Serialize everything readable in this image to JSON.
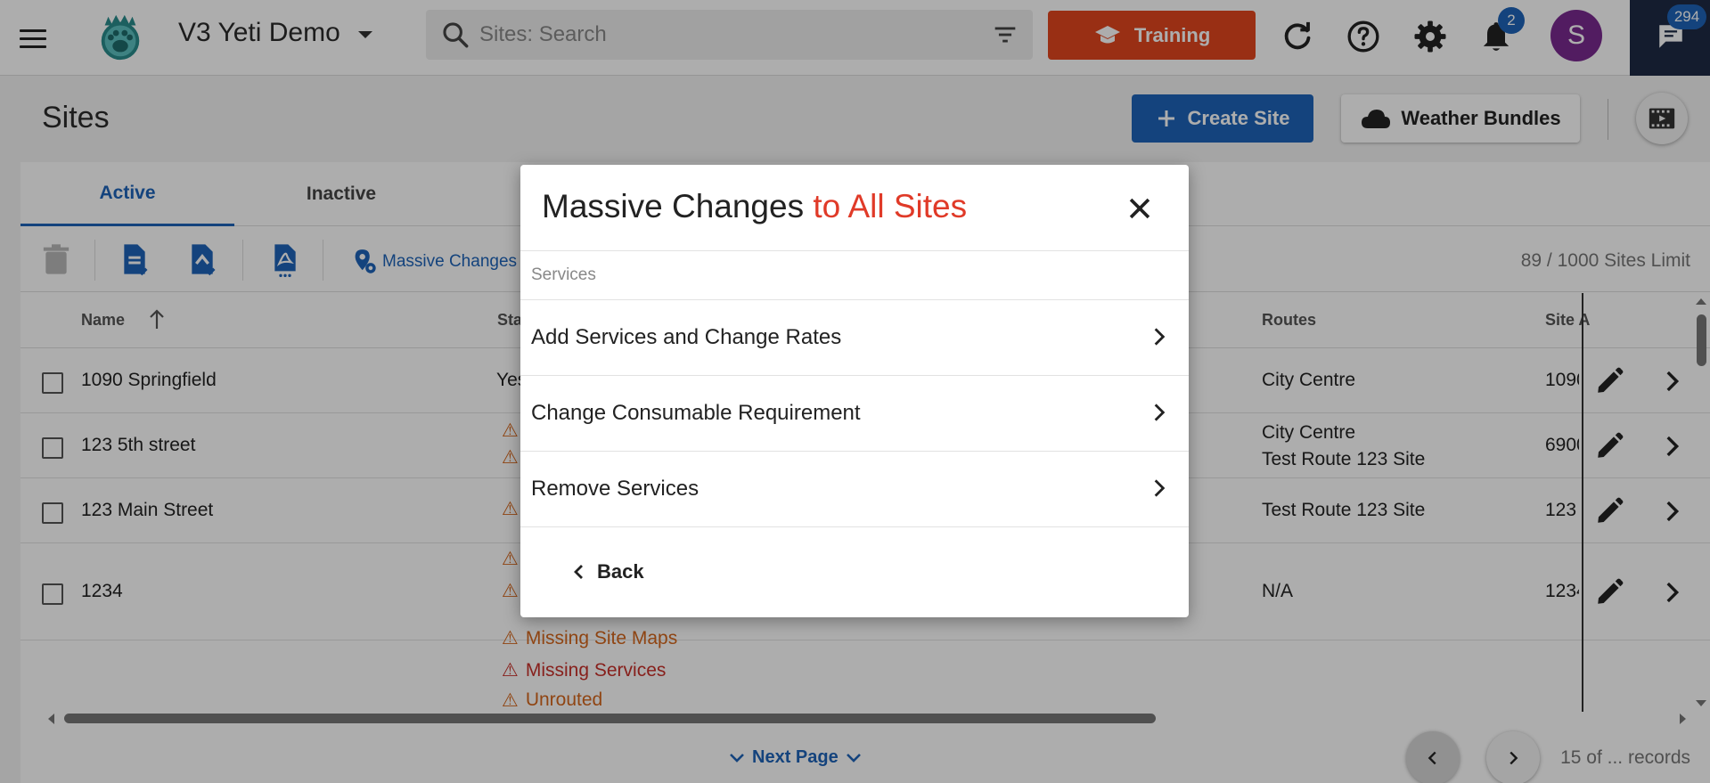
{
  "topbar": {
    "company_name": "V3 Yeti Demo",
    "search_placeholder": "Sites: Search",
    "training_label": "Training",
    "notifications_count": "2",
    "avatar_initial": "S",
    "chat_count": "294"
  },
  "page": {
    "title": "Sites",
    "create_site_label": "Create Site",
    "weather_bundles_label": "Weather Bundles"
  },
  "tabs": [
    "Active",
    "Inactive"
  ],
  "toolbar": {
    "massive_changes_label": "Massive Changes",
    "sites_limit": "89 / 1000 Sites Limit"
  },
  "table": {
    "columns": {
      "name": "Name",
      "status": "Sta",
      "routes": "Routes",
      "site_address": "Site A"
    },
    "rows": [
      {
        "name": "1090 Springfield",
        "status": "Yes",
        "routes": [
          "City Centre"
        ],
        "site_address": "1090"
      },
      {
        "name": "123 5th street",
        "routes": [
          "City Centre",
          "Test Route 123 Site"
        ],
        "site_address": "6900"
      },
      {
        "name": "123 Main Street",
        "routes": [
          "Test Route 123 Site"
        ],
        "site_address": "123"
      },
      {
        "name": "1234",
        "routes": [
          "N/A"
        ],
        "site_address": "1234"
      }
    ],
    "warnings": [
      "Missing Site Maps",
      "Missing Services",
      "Unrouted"
    ]
  },
  "footer": {
    "next_page_label": "Next Page",
    "records_label": "15 of ... records"
  },
  "modal": {
    "title_main": "Massive Changes",
    "title_accent": "to All Sites",
    "section": "Services",
    "options": [
      "Add Services and Change Rates",
      "Change Consumable Requirement",
      "Remove Services"
    ],
    "back_label": "Back"
  },
  "colors": {
    "primary_blue": "#1e64b8",
    "training_orange": "#e2461e",
    "accent_red": "#e03a28",
    "warning_orange": "#d4661c",
    "warning_red": "#c8302a",
    "avatar_purple": "#7a2a8f",
    "chat_navy": "#1e2a45"
  },
  "icons": [
    "menu-icon",
    "yeti-paw-logo",
    "search-icon",
    "filter-icon",
    "graduation-cap-icon",
    "refresh-icon",
    "help-icon",
    "gear-icon",
    "bell-icon",
    "chat-icon",
    "plus-icon",
    "cloud-icon",
    "video-icon",
    "trash-icon",
    "export-icon",
    "import-icon",
    "pdf-icon",
    "location-gear-icon",
    "sort-up-icon",
    "warning-icon",
    "pencil-icon",
    "chevron-right-icon",
    "chevron-left-icon",
    "chevron-down-icon",
    "close-icon"
  ]
}
